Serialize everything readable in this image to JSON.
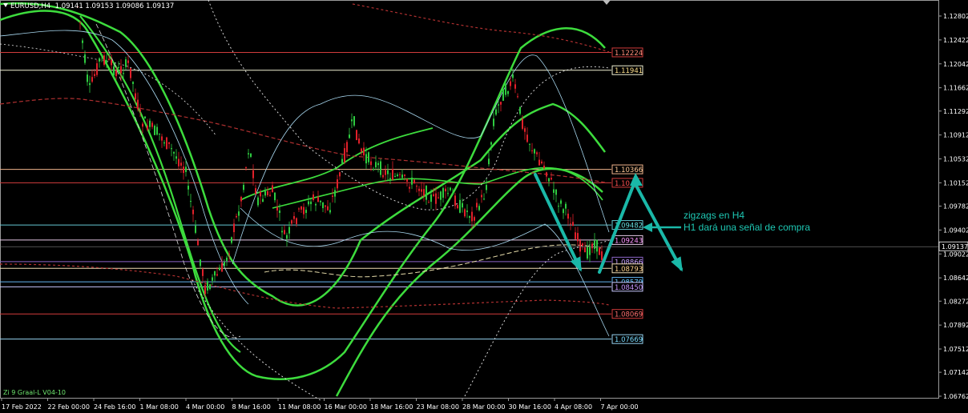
{
  "window": {
    "symbol_label": "EURUSD,H4",
    "ohlc": "1.09141 1.09153 1.09086 1.09137",
    "indicator_label": "Zi 9 Graal-L V04-10"
  },
  "price_axis": {
    "ticks": [
      "1.12802",
      "1.12422",
      "1.12042",
      "1.11662",
      "1.11292",
      "1.10912",
      "1.10532",
      "1.10152",
      "1.09782",
      "1.09402",
      "1.09022",
      "1.08642",
      "1.08272",
      "1.07892",
      "1.07512",
      "1.07142",
      "1.06762"
    ],
    "current_price": "1.09137",
    "current_price_color": "#ffffff"
  },
  "time_axis": {
    "labels": [
      "17 Feb 2022",
      "22 Feb 00:00",
      "24 Feb 16:00",
      "1 Mar 08:00",
      "4 Mar 00:00",
      "8 Mar 16:00",
      "11 Mar 08:00",
      "16 Mar 00:00",
      "18 Mar 16:00",
      "23 Mar 08:00",
      "28 Mar 00:00",
      "30 Mar 16:00",
      "4 Apr 08:00",
      "7 Apr 00:00"
    ]
  },
  "level_lines": [
    {
      "label": "1.12224",
      "price": 1.12224,
      "color": "#d23c3c",
      "text_color": "#ff8c78"
    },
    {
      "label": "1.11941",
      "price": 1.11941,
      "color": "#f0f0d2",
      "text_color": "#ffe08c"
    },
    {
      "label": "1.10366",
      "price": 1.10366,
      "color": "#f0b48c",
      "text_color": "#ffc896"
    },
    {
      "label": "1.10",
      "price": 1.10152,
      "color": "#d23c3c",
      "text_color": "#ff5050"
    },
    {
      "label": "1.09482",
      "price": 1.09482,
      "color": "#64c8d2",
      "text_color": "#64dcdc"
    },
    {
      "label": "1.09243",
      "price": 1.09243,
      "color": "#e6c8e6",
      "text_color": "#ff96ff"
    },
    {
      "label": "1.08866",
      "price": 1.089,
      "color": "#8c64c8",
      "text_color": "#c8a0ff"
    },
    {
      "label": "1.08793",
      "price": 1.08793,
      "color": "#f0dcb4",
      "text_color": "#ffd28c"
    },
    {
      "label": "1.08579",
      "price": 1.08579,
      "color": "#64b4f0",
      "text_color": "#64c8ff"
    },
    {
      "label": "1.08450",
      "price": 1.085,
      "color": "#c8c8ff",
      "text_color": "#c896ff"
    },
    {
      "label": "1.08069",
      "price": 1.08069,
      "color": "#d23c3c",
      "text_color": "#ff6e6e"
    },
    {
      "label": "1.07669",
      "price": 1.07669,
      "color": "#96d2f0",
      "text_color": "#78dcff"
    }
  ],
  "annotation": {
    "line1": "zigzags en H4",
    "line2": "H1 dará una señal de compra",
    "color": "#1ec8b4"
  },
  "colors": {
    "bull_candle": "#2ecc40",
    "bear_candle": "#e0202a",
    "envelope_green": "#3ddc3d",
    "arrow_teal": "#1ab8a8"
  }
}
